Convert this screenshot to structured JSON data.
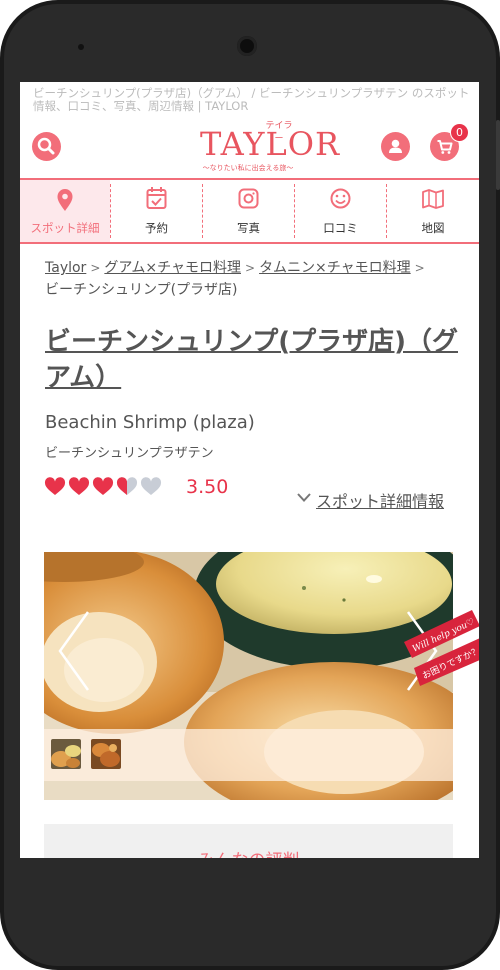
{
  "page": {
    "title": "ビーチンシュリンプ(プラザ店)（グアム） / ビーチンシュリンプラザテン のスポット情報、口コミ、写真、周辺情報 | TAYLOR"
  },
  "header": {
    "logo_ruby": "テイラー",
    "logo_text": "TAYLOR",
    "logo_tagline": "〜なりたい私に出会える旅〜",
    "cart_count": "0"
  },
  "nav": {
    "items": [
      {
        "label": "スポット詳細",
        "icon": "map-pin-icon",
        "active": true
      },
      {
        "label": "予約",
        "icon": "calendar-check-icon",
        "active": false
      },
      {
        "label": "写真",
        "icon": "camera-icon",
        "active": false
      },
      {
        "label": "口コミ",
        "icon": "smiley-icon",
        "active": false
      },
      {
        "label": "地図",
        "icon": "map-icon",
        "active": false
      }
    ]
  },
  "breadcrumb": {
    "items": [
      "Taylor",
      "グアム×チャモロ料理",
      "タムニン×チャモロ料理"
    ],
    "current": "ビーチンシュリンプ(プラザ店)"
  },
  "spot": {
    "name": "ビーチンシュリンプ(プラザ店)（グアム）",
    "name_en": "Beachin Shrimp (plaza)",
    "name_kana": "ビーチンシュリンプラザテン",
    "rating": "3.50",
    "rating_value": 3.5,
    "rating_max": 5,
    "details_link": "スポット詳細情報"
  },
  "gallery": {
    "thumbnail_count": 2,
    "help_ribbon_top": "Will help you♡",
    "help_ribbon_bottom": "お困りですか？"
  },
  "reviews": {
    "title": "みんなの評判"
  },
  "colors": {
    "accent": "#f26e7a",
    "rating": "#e8334a",
    "logo": "#e8555f"
  }
}
